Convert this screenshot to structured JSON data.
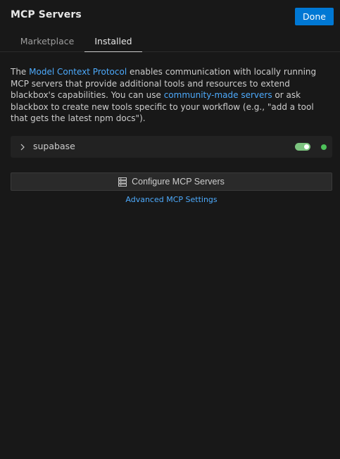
{
  "header": {
    "title": "MCP Servers",
    "done_label": "Done"
  },
  "tabs": [
    {
      "label": "Marketplace",
      "active": false
    },
    {
      "label": "Installed",
      "active": true
    }
  ],
  "description": {
    "part1": "The ",
    "link1": "Model Context Protocol",
    "part2": " enables communication with locally running MCP servers that provide additional tools and resources to extend blackbox's capabilities. You can use ",
    "link2": "community-made servers",
    "part3": " or ask blackbox to create new tools specific to your workflow (e.g., \"add a tool that gets the latest npm docs\")."
  },
  "servers": [
    {
      "name": "supabase",
      "enabled": true,
      "status": "connected"
    }
  ],
  "actions": {
    "configure_label": "Configure MCP Servers",
    "advanced_label": "Advanced MCP Settings"
  },
  "colors": {
    "background": "#181818",
    "accent": "#0078d4",
    "link": "#4daafc",
    "toggle_on": "#7cc47f",
    "status_connected": "#4ec25a"
  }
}
